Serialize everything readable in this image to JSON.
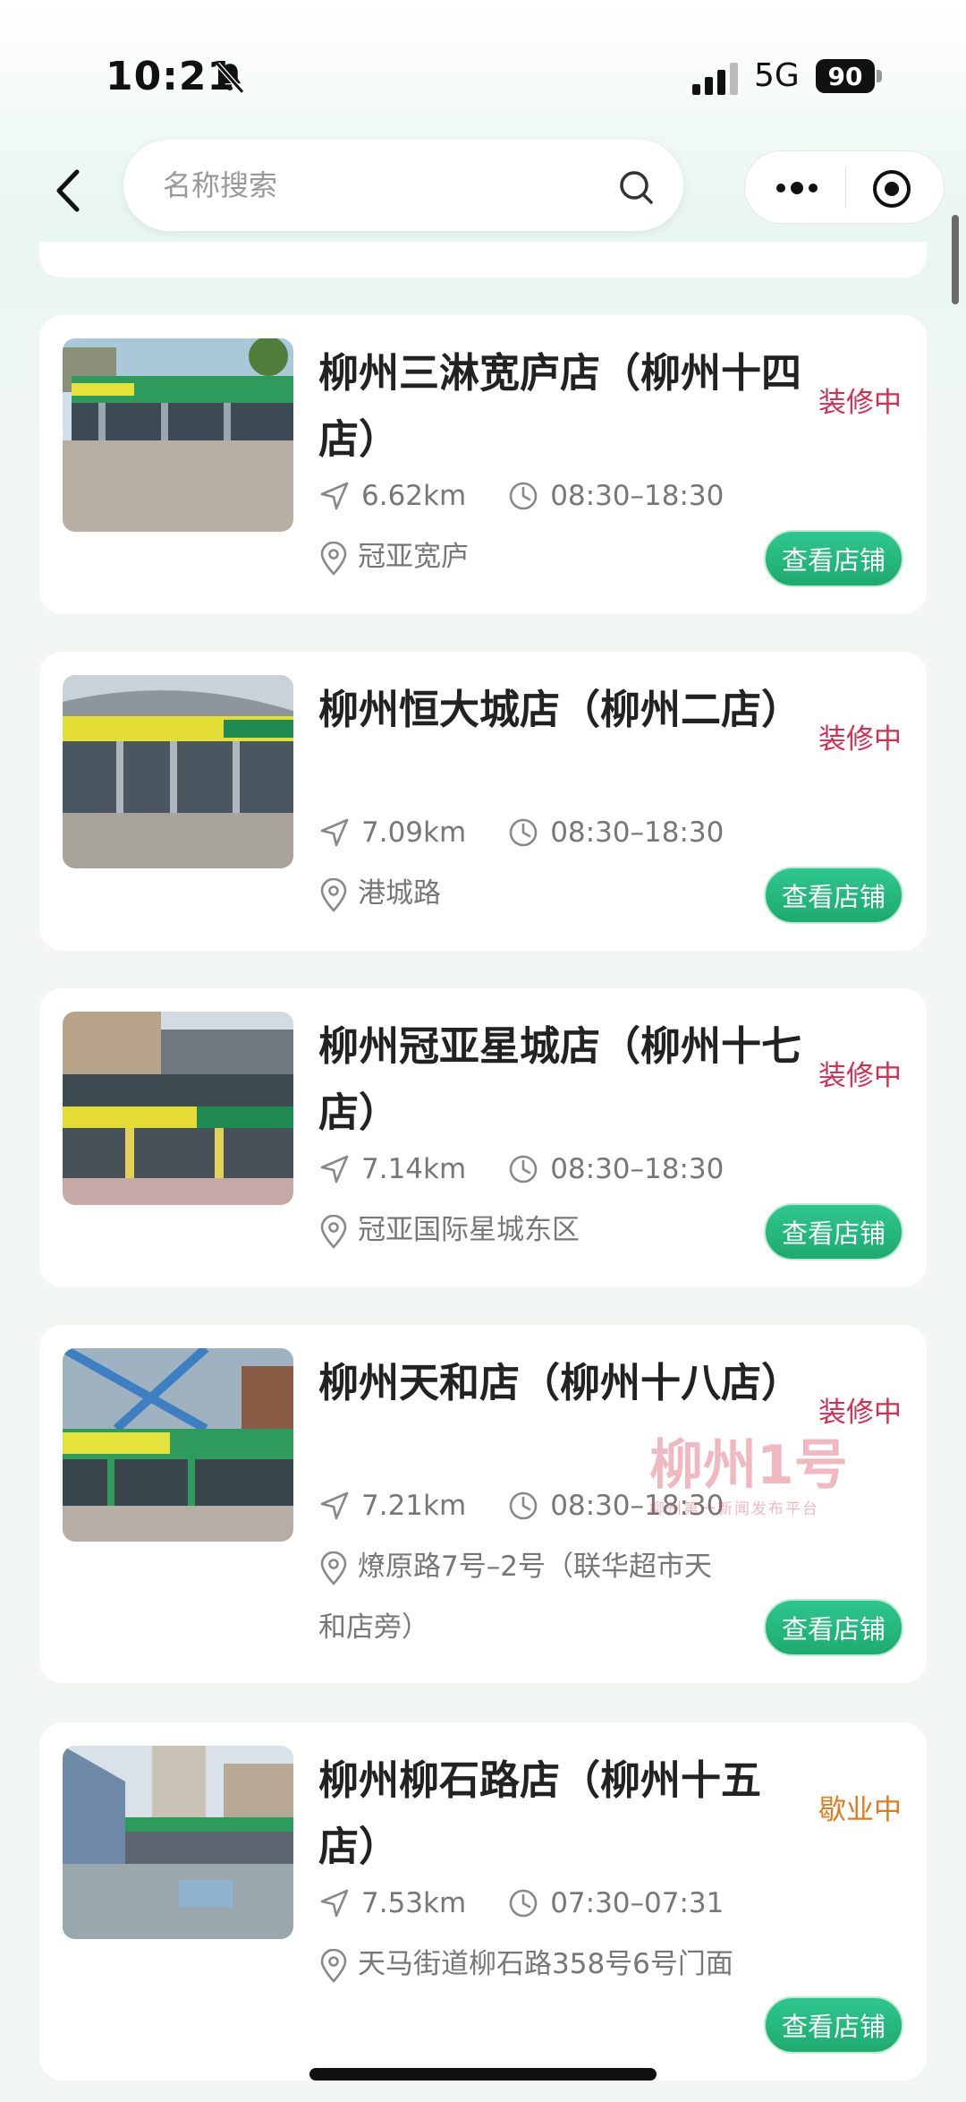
{
  "status_bar": {
    "time": "10:21",
    "network": "5G",
    "battery": "90"
  },
  "search": {
    "placeholder": "名称搜索"
  },
  "colors": {
    "accent_green": "#22b87b",
    "status_renovating": "#d62e4f",
    "status_closed": "#e07a1f"
  },
  "stores": [
    {
      "name": "柳州三淋宽庐店（柳州十四店）",
      "status": "装修中",
      "distance": "6.62km",
      "hours": "08:30–18:30",
      "address": "冠亚宽庐",
      "button": "查看店铺"
    },
    {
      "name": "柳州恒大城店（柳州二店）",
      "status": "装修中",
      "distance": "7.09km",
      "hours": "08:30–18:30",
      "address": "港城路",
      "button": "查看店铺"
    },
    {
      "name": "柳州冠亚星城店（柳州十七店）",
      "status": "装修中",
      "distance": "7.14km",
      "hours": "08:30–18:30",
      "address": "冠亚国际星城东区",
      "button": "查看店铺"
    },
    {
      "name": "柳州天和店（柳州十八店）",
      "status": "装修中",
      "distance": "7.21km",
      "hours": "08:30–18:30",
      "address": "燎原路7号–2号（联华超市天和店旁）",
      "button": "查看店铺"
    },
    {
      "name": "柳州柳石路店（柳州十五店）",
      "status": "歇业中",
      "distance": "7.53km",
      "hours": "07:30–07:31",
      "address": "天马街道柳石路358号6号门面",
      "button": "查看店铺"
    }
  ],
  "watermark": {
    "main": "柳州1号",
    "sub": "柳州第一新闻发布平台"
  }
}
